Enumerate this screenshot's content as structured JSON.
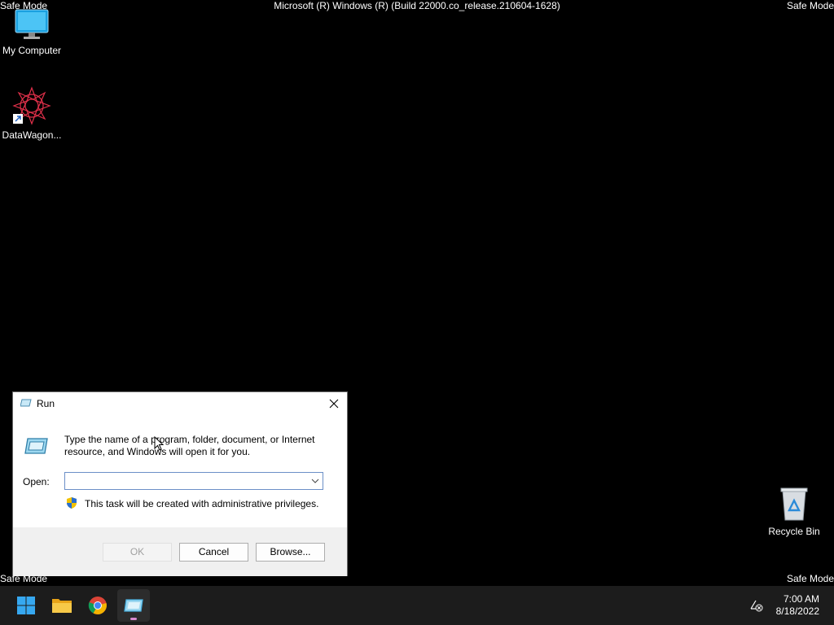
{
  "desktop": {
    "safe_mode_labels": [
      "Safe Mode",
      "Safe Mode",
      "Safe Mode",
      "Safe Mode"
    ],
    "build_string": "Microsoft (R) Windows (R) (Build 22000.co_release.210604-1628)",
    "icons": [
      {
        "label": "My Computer",
        "icon": "monitor-icon"
      },
      {
        "label": "DataWagon...",
        "icon": "datawagon-logo-icon"
      },
      {
        "label": "Recycle Bin",
        "icon": "recycle-bin-icon"
      }
    ]
  },
  "run_dialog": {
    "title": "Run",
    "description": "Type the name of a program, folder, document, or Internet resource, and Windows will open it for you.",
    "open_label": "Open:",
    "open_value": "",
    "admin_notice": "This task will be created with administrative privileges.",
    "buttons": {
      "ok": "OK",
      "cancel": "Cancel",
      "browse": "Browse..."
    }
  },
  "taskbar": {
    "apps": [
      "start-icon",
      "file-explorer-icon",
      "chrome-icon",
      "run-icon"
    ],
    "time": "7:00 AM",
    "date": "8/18/2022"
  },
  "colors": {
    "desktop_bg": "#000000",
    "taskbar_bg": "#1c1c1c",
    "accent": "#0078d4"
  }
}
